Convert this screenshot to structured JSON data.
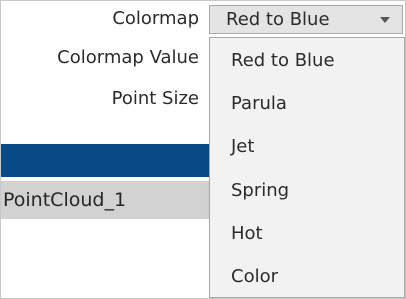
{
  "properties": {
    "colormap_label": "Colormap",
    "colormap_value_label": "Colormap Value",
    "point_size_label": "Point Size"
  },
  "colormap_select": {
    "selected": "Red to Blue",
    "options": [
      "Red to Blue",
      "Parula",
      "Jet",
      "Spring",
      "Hot",
      "Color"
    ]
  },
  "scene_list": {
    "selected_item": "PointCloud_1"
  },
  "colors": {
    "selection_bar": "#0a4a84",
    "row_highlight": "#d2d2d2",
    "dropdown_bg": "#f2f2f2"
  },
  "icons": {
    "select_arrow": "chevron-down-icon"
  }
}
